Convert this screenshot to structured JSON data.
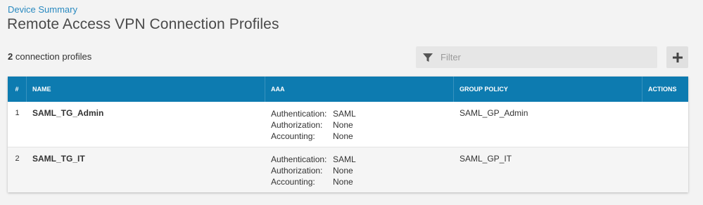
{
  "breadcrumb": "Device Summary",
  "title": "Remote Access VPN Connection Profiles",
  "count": {
    "number": "2",
    "label": "connection profiles"
  },
  "filter": {
    "placeholder": "Filter"
  },
  "table": {
    "headers": [
      "#",
      "NAME",
      "AAA",
      "GROUP POLICY",
      "ACTIONS"
    ],
    "rows": [
      {
        "index": "1",
        "name": "SAML_TG_Admin",
        "aaa": [
          {
            "label": "Authentication:",
            "value": "SAML"
          },
          {
            "label": "Authorization:",
            "value": "None"
          },
          {
            "label": "Accounting:",
            "value": "None"
          }
        ],
        "group_policy": "SAML_GP_Admin"
      },
      {
        "index": "2",
        "name": "SAML_TG_IT",
        "aaa": [
          {
            "label": "Authentication:",
            "value": "SAML"
          },
          {
            "label": "Authorization:",
            "value": "None"
          },
          {
            "label": "Accounting:",
            "value": "None"
          }
        ],
        "group_policy": "SAML_GP_IT"
      }
    ]
  },
  "colors": {
    "header": "#0d7bb0",
    "link": "#2a8ac0"
  },
  "icons": {
    "filter": "filter-funnel-icon",
    "add": "plus-icon"
  }
}
